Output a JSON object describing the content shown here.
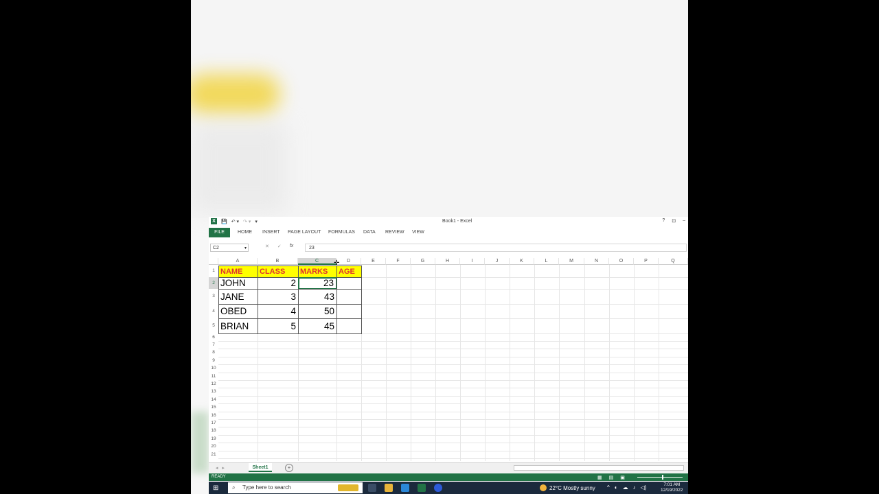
{
  "window": {
    "title": "Book1 - Excel"
  },
  "titlebar": {
    "help": "?",
    "restore": "⊡",
    "minimize": "–"
  },
  "ribbon": {
    "file": "FILE",
    "tabs": [
      "HOME",
      "INSERT",
      "PAGE LAYOUT",
      "FORMULAS",
      "DATA",
      "REVIEW",
      "VIEW"
    ]
  },
  "formula_bar": {
    "name_box": "C2",
    "value": "23",
    "fx_label": "fx"
  },
  "columns": [
    "A",
    "B",
    "C",
    "D",
    "E",
    "F",
    "G",
    "H",
    "I",
    "J",
    "K",
    "L",
    "M",
    "N",
    "O",
    "P",
    "Q"
  ],
  "selected_column": "C",
  "rows": [
    "1",
    "2",
    "3",
    "4",
    "5",
    "6",
    "7",
    "8",
    "9",
    "10",
    "11",
    "12",
    "13",
    "14",
    "15",
    "16",
    "17",
    "18",
    "19",
    "20",
    "21"
  ],
  "selected_row": "2",
  "table": {
    "headers": [
      "NAME",
      "CLASS",
      "MARKS",
      "AGE"
    ],
    "rows": [
      {
        "name": "JOHN",
        "class": "2",
        "marks": "23",
        "age": ""
      },
      {
        "name": "JANE",
        "class": "3",
        "marks": "43",
        "age": ""
      },
      {
        "name": "OBED",
        "class": "4",
        "marks": "50",
        "age": ""
      },
      {
        "name": "BRIAN",
        "class": "5",
        "marks": "45",
        "age": ""
      }
    ]
  },
  "sheets": {
    "active": "Sheet1",
    "add": "+"
  },
  "status": {
    "text": "READY"
  },
  "taskbar": {
    "search_placeholder": "Type here to search",
    "weather": "22°C  Mostly sunny",
    "time": "7:01 AM",
    "date": "12/19/2022"
  },
  "colors": {
    "excel_green": "#217346",
    "header_fill": "#ffff00",
    "header_text": "#e03030"
  }
}
